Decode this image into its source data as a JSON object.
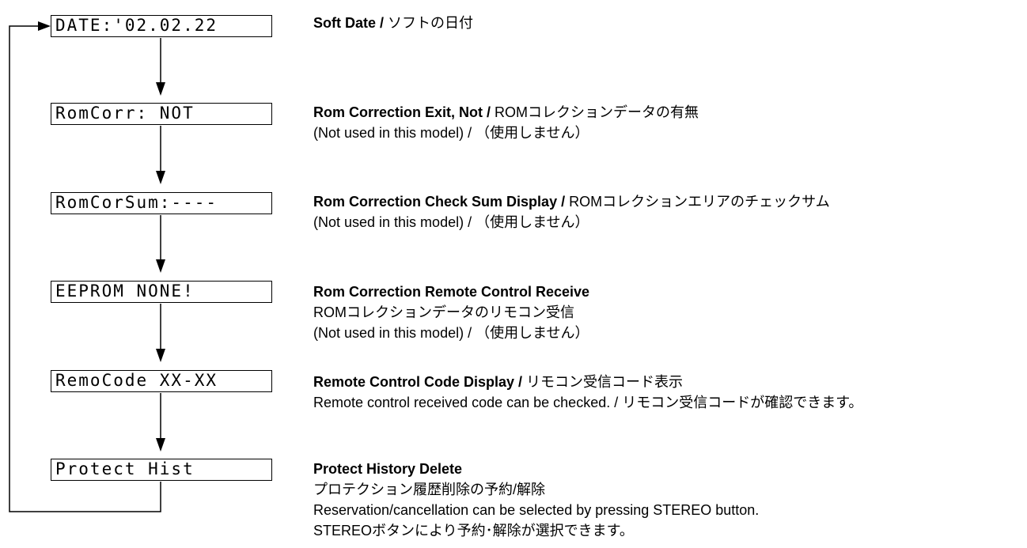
{
  "steps": [
    {
      "display": "DATE:'02.02.22",
      "title": "Soft Date /",
      "title_jp": "ソフトの日付",
      "lines": []
    },
    {
      "display": "RomCorr: NOT",
      "title": "Rom Correction Exit, Not /",
      "title_jp": "ROMコレクションデータの有無",
      "lines": [
        "(Not used in this model) / （使用しません）"
      ]
    },
    {
      "display": "RomCorSum:----",
      "title": "Rom Correction Check Sum Display /",
      "title_jp": "ROMコレクションエリアのチェックサム",
      "lines": [
        "(Not used in this model) / （使用しません）"
      ]
    },
    {
      "display": "EEPROM NONE!",
      "title": "Rom Correction Remote Control Receive",
      "title_jp": "",
      "lines": [
        "ROMコレクションデータのリモコン受信",
        "(Not used in this model) / （使用しません）"
      ]
    },
    {
      "display": "RemoCode XX-XX",
      "title": "Remote Control Code Display /",
      "title_jp": "リモコン受信コード表示",
      "lines": [
        "Remote control received code can be checked. / リモコン受信コードが確認できます。"
      ]
    },
    {
      "display": "Protect Hist",
      "title": "Protect History Delete",
      "title_jp": "",
      "lines": [
        "プロテクション履歴削除の予約/解除",
        "Reservation/cancellation can be selected by pressing STEREO button.",
        "STEREOボタンにより予約･解除が選択できます。"
      ]
    }
  ]
}
